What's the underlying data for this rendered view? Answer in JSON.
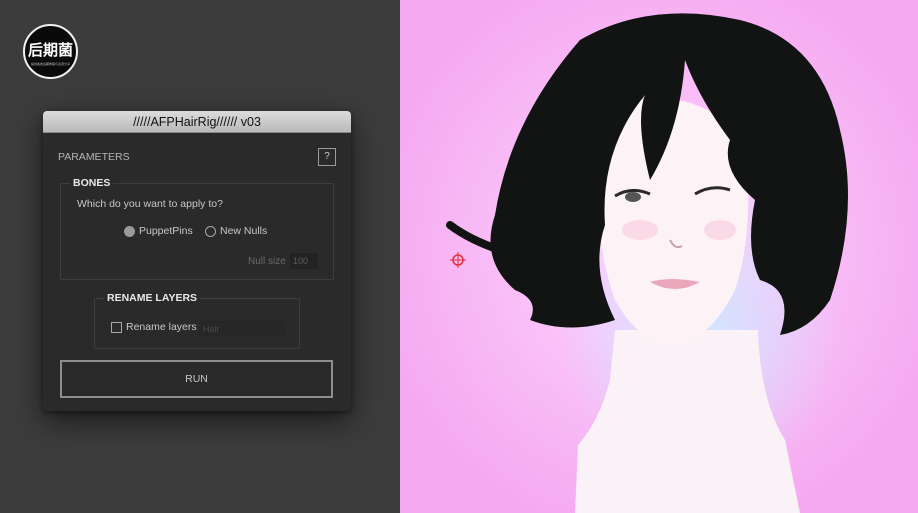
{
  "logo": {
    "text": "后期菌",
    "subtext": "提供各类后期教程与资源分享"
  },
  "panel": {
    "title": "/////AFPHairRig////// v03",
    "parameters_label": "PARAMETERS",
    "help_label": "?",
    "bones": {
      "title": "BONES",
      "question": "Which do you want to apply to?",
      "options": [
        {
          "label": "PuppetPins",
          "selected": true
        },
        {
          "label": "New Nulls",
          "selected": false
        }
      ],
      "null_size_label": "Null size",
      "null_size_value": "100"
    },
    "rename": {
      "title": "RENAME LAYERS",
      "checkbox_label": "Rename layers",
      "checked": false,
      "name_value": "Hair"
    },
    "run_label": "RUN"
  },
  "colors": {
    "panel_bg": "#2a2a2a",
    "workspace_bg": "#3c3c3c",
    "canvas_pink": "#f4a8f0",
    "anchor_red": "#e0303a"
  }
}
